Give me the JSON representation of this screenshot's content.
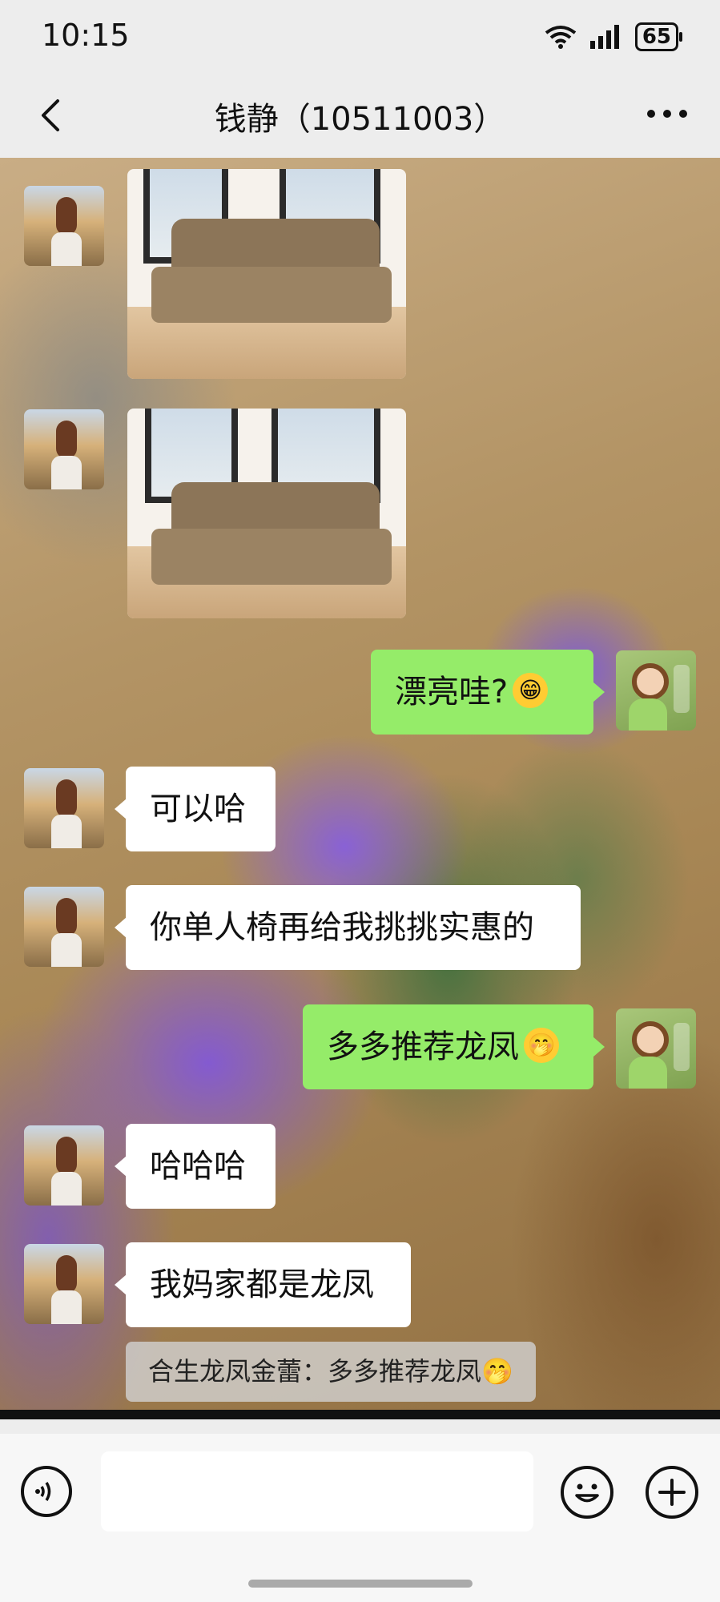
{
  "status_bar": {
    "time": "10:15",
    "wifi_icon": "wifi-icon",
    "signal_icon": "signal-icon",
    "battery_level": "65"
  },
  "nav": {
    "back_icon": "chevron-left-icon",
    "title": "钱静（10511003）",
    "more_icon": "more-horizontal-icon"
  },
  "messages": [
    {
      "side": "left",
      "type": "image",
      "description_icon": "sofa-photo"
    },
    {
      "side": "left",
      "type": "image",
      "description_icon": "sofa-photo"
    },
    {
      "side": "right",
      "type": "text",
      "text": "漂亮哇?",
      "emoji_icon": "grinning-face-icon"
    },
    {
      "side": "left",
      "type": "text",
      "text": "可以哈"
    },
    {
      "side": "left",
      "type": "text",
      "text": "你单人椅再给我挑挑实惠的"
    },
    {
      "side": "right",
      "type": "text",
      "text": "多多推荐龙凤",
      "emoji_icon": "face-with-hand-over-mouth-icon"
    },
    {
      "side": "left",
      "type": "text",
      "text": "哈哈哈"
    },
    {
      "side": "left",
      "type": "text",
      "text": "我妈家都是龙凤"
    }
  ],
  "quote": {
    "text": "合生龙凤金蕾：多多推荐龙凤",
    "emoji_icon": "face-with-hand-over-mouth-icon"
  },
  "input_bar": {
    "voice_icon": "voice-icon",
    "input_value": "",
    "emoji_icon": "smiley-icon",
    "plus_icon": "plus-icon"
  },
  "colors": {
    "outgoing_bubble": "#95ec69",
    "incoming_bubble": "#ffffff",
    "bar_background": "#ededed"
  }
}
